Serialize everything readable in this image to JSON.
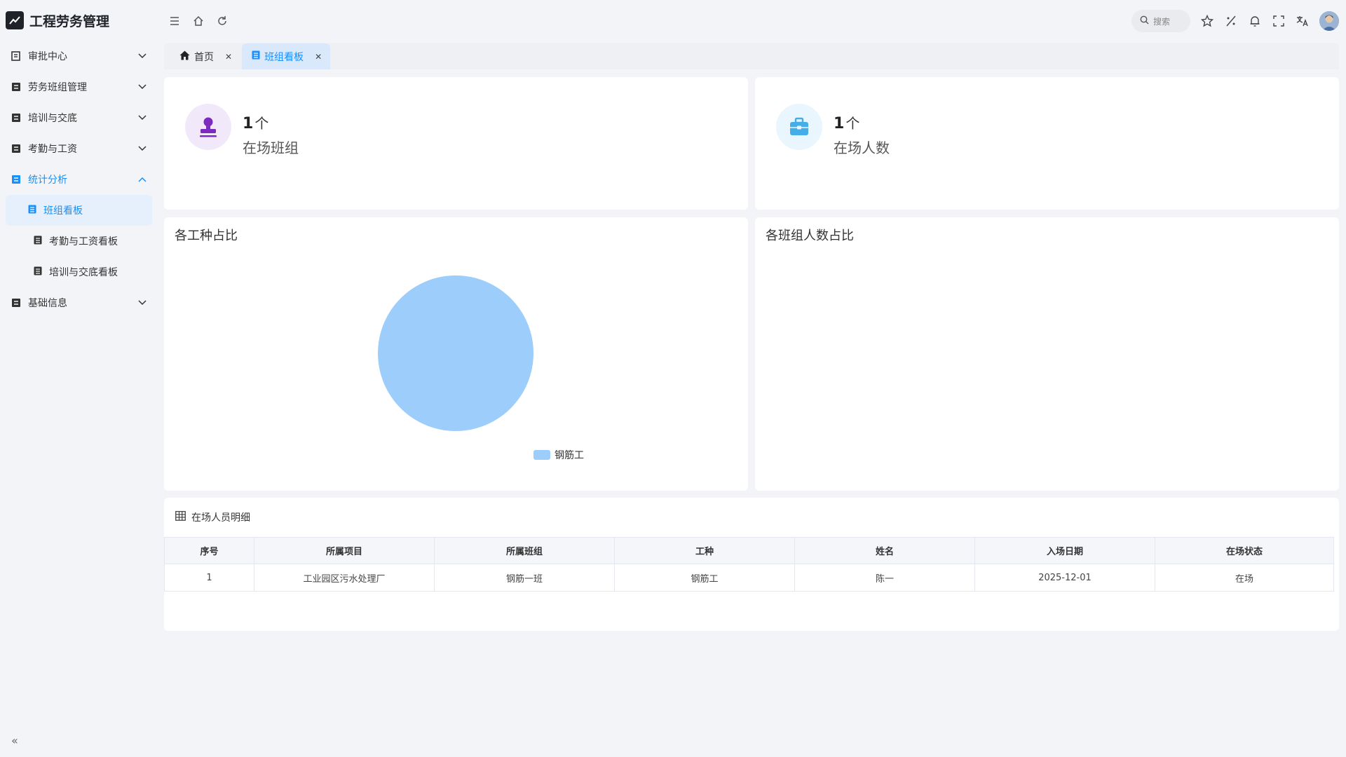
{
  "app": {
    "title": "工程劳务管理"
  },
  "sidebar": {
    "items": [
      {
        "label": "审批中心",
        "icon": "approval-icon",
        "expanded": false
      },
      {
        "label": "劳务班组管理",
        "icon": "list-icon",
        "expanded": false
      },
      {
        "label": "培训与交底",
        "icon": "list-icon",
        "expanded": false
      },
      {
        "label": "考勤与工资",
        "icon": "list-icon",
        "expanded": false
      },
      {
        "label": "统计分析",
        "icon": "list-icon",
        "expanded": true
      },
      {
        "label": "基础信息",
        "icon": "list-icon",
        "expanded": false
      }
    ],
    "sub_items": [
      {
        "label": "班组看板",
        "selected": true
      },
      {
        "label": "考勤与工资看板",
        "selected": false
      },
      {
        "label": "培训与交底看板",
        "selected": false
      }
    ]
  },
  "header": {
    "search_placeholder": "搜索"
  },
  "tabs": [
    {
      "label": "首页",
      "icon": "home-icon",
      "active": false
    },
    {
      "label": "班组看板",
      "icon": "document-icon",
      "active": true
    }
  ],
  "stats": [
    {
      "value": "1",
      "unit": "个",
      "label": "在场班组",
      "color": "#7b2cbf",
      "bg": "#f1e9fa"
    },
    {
      "value": "1",
      "unit": "个",
      "label": "在场人数",
      "color": "#45aee8",
      "bg": "#eaf6fd"
    }
  ],
  "charts": {
    "left_title": "各工种占比",
    "right_title": "各班组人数占比"
  },
  "chart_data": {
    "type": "pie",
    "title": "各工种占比",
    "categories": [
      "钢筋工"
    ],
    "values": [
      1
    ],
    "colors": [
      "#9ccdfb"
    ],
    "legend": "bottom-right"
  },
  "table": {
    "title": "在场人员明细",
    "columns": [
      "序号",
      "所属项目",
      "所属班组",
      "工种",
      "姓名",
      "入场日期",
      "在场状态"
    ],
    "rows": [
      [
        "1",
        "工业园区污水处理厂",
        "钢筋一班",
        "钢筋工",
        "陈一",
        "2025-12-01",
        "在场"
      ]
    ]
  }
}
